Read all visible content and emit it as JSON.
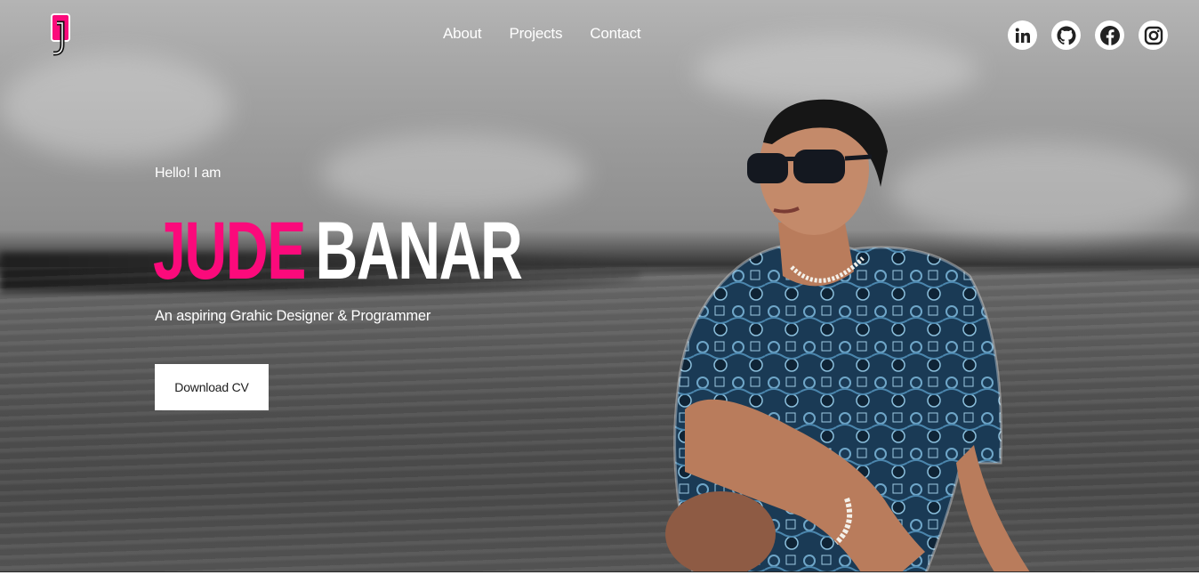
{
  "nav": {
    "items": [
      "About",
      "Projects",
      "Contact"
    ]
  },
  "socials": [
    {
      "icon": "linkedin-icon",
      "label": "in"
    },
    {
      "icon": "github-icon"
    },
    {
      "icon": "facebook-icon"
    },
    {
      "icon": "instagram-icon"
    }
  ],
  "hero": {
    "greeting": "Hello! I am",
    "first_name": "JUDE",
    "last_name": "BANAR",
    "tagline": "An aspiring Grahic Designer & Programmer",
    "cv_button": "Download CV"
  },
  "colors": {
    "accent": "#fb0a7b",
    "text": "#ffffff"
  }
}
